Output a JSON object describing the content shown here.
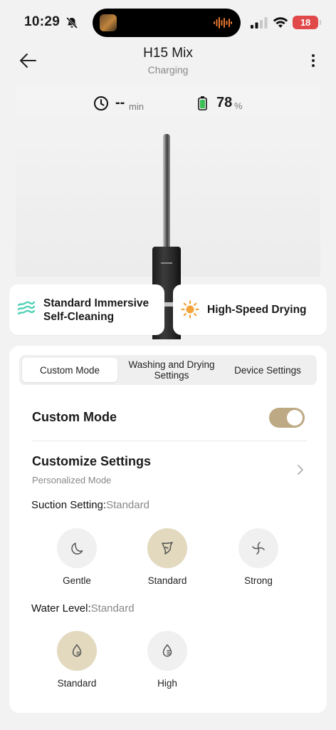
{
  "status": {
    "time": "10:29",
    "battery": "18"
  },
  "header": {
    "title": "H15 Mix",
    "subtitle": "Charging"
  },
  "device": {
    "remaining_time": "--",
    "time_unit": "min",
    "battery": "78",
    "battery_unit": "%"
  },
  "modes": [
    {
      "label": "Standard Immersive Self-Cleaning",
      "icon": "waves-icon",
      "color": "#4fd1b5"
    },
    {
      "label": "High-Speed Drying",
      "icon": "sun-icon",
      "color": "#f2a33a"
    }
  ],
  "tabs": [
    {
      "label": "Custom Mode",
      "active": true
    },
    {
      "label": "Washing and Drying Settings",
      "active": false
    },
    {
      "label": "Device Settings",
      "active": false
    }
  ],
  "custom_mode": {
    "label": "Custom Mode",
    "enabled": true
  },
  "customize": {
    "title": "Customize Settings",
    "subtitle": "Personalized Mode"
  },
  "suction": {
    "label": "Suction Setting:",
    "value": "Standard",
    "options": [
      {
        "label": "Gentle",
        "icon": "gentle-suction-icon",
        "selected": false
      },
      {
        "label": "Standard",
        "icon": "standard-suction-icon",
        "selected": true
      },
      {
        "label": "Strong",
        "icon": "strong-suction-icon",
        "selected": false
      }
    ]
  },
  "water": {
    "label": "Water Level:",
    "value": "Standard",
    "options": [
      {
        "label": "Standard",
        "icon": "water-drop-icon",
        "selected": true
      },
      {
        "label": "High",
        "icon": "water-drop-icon",
        "selected": false
      }
    ]
  },
  "colors": {
    "accent": "#bda983",
    "selected_bg": "#e3d9bf",
    "battery_green": "#3bbf55",
    "status_battery": "#e0484a"
  }
}
